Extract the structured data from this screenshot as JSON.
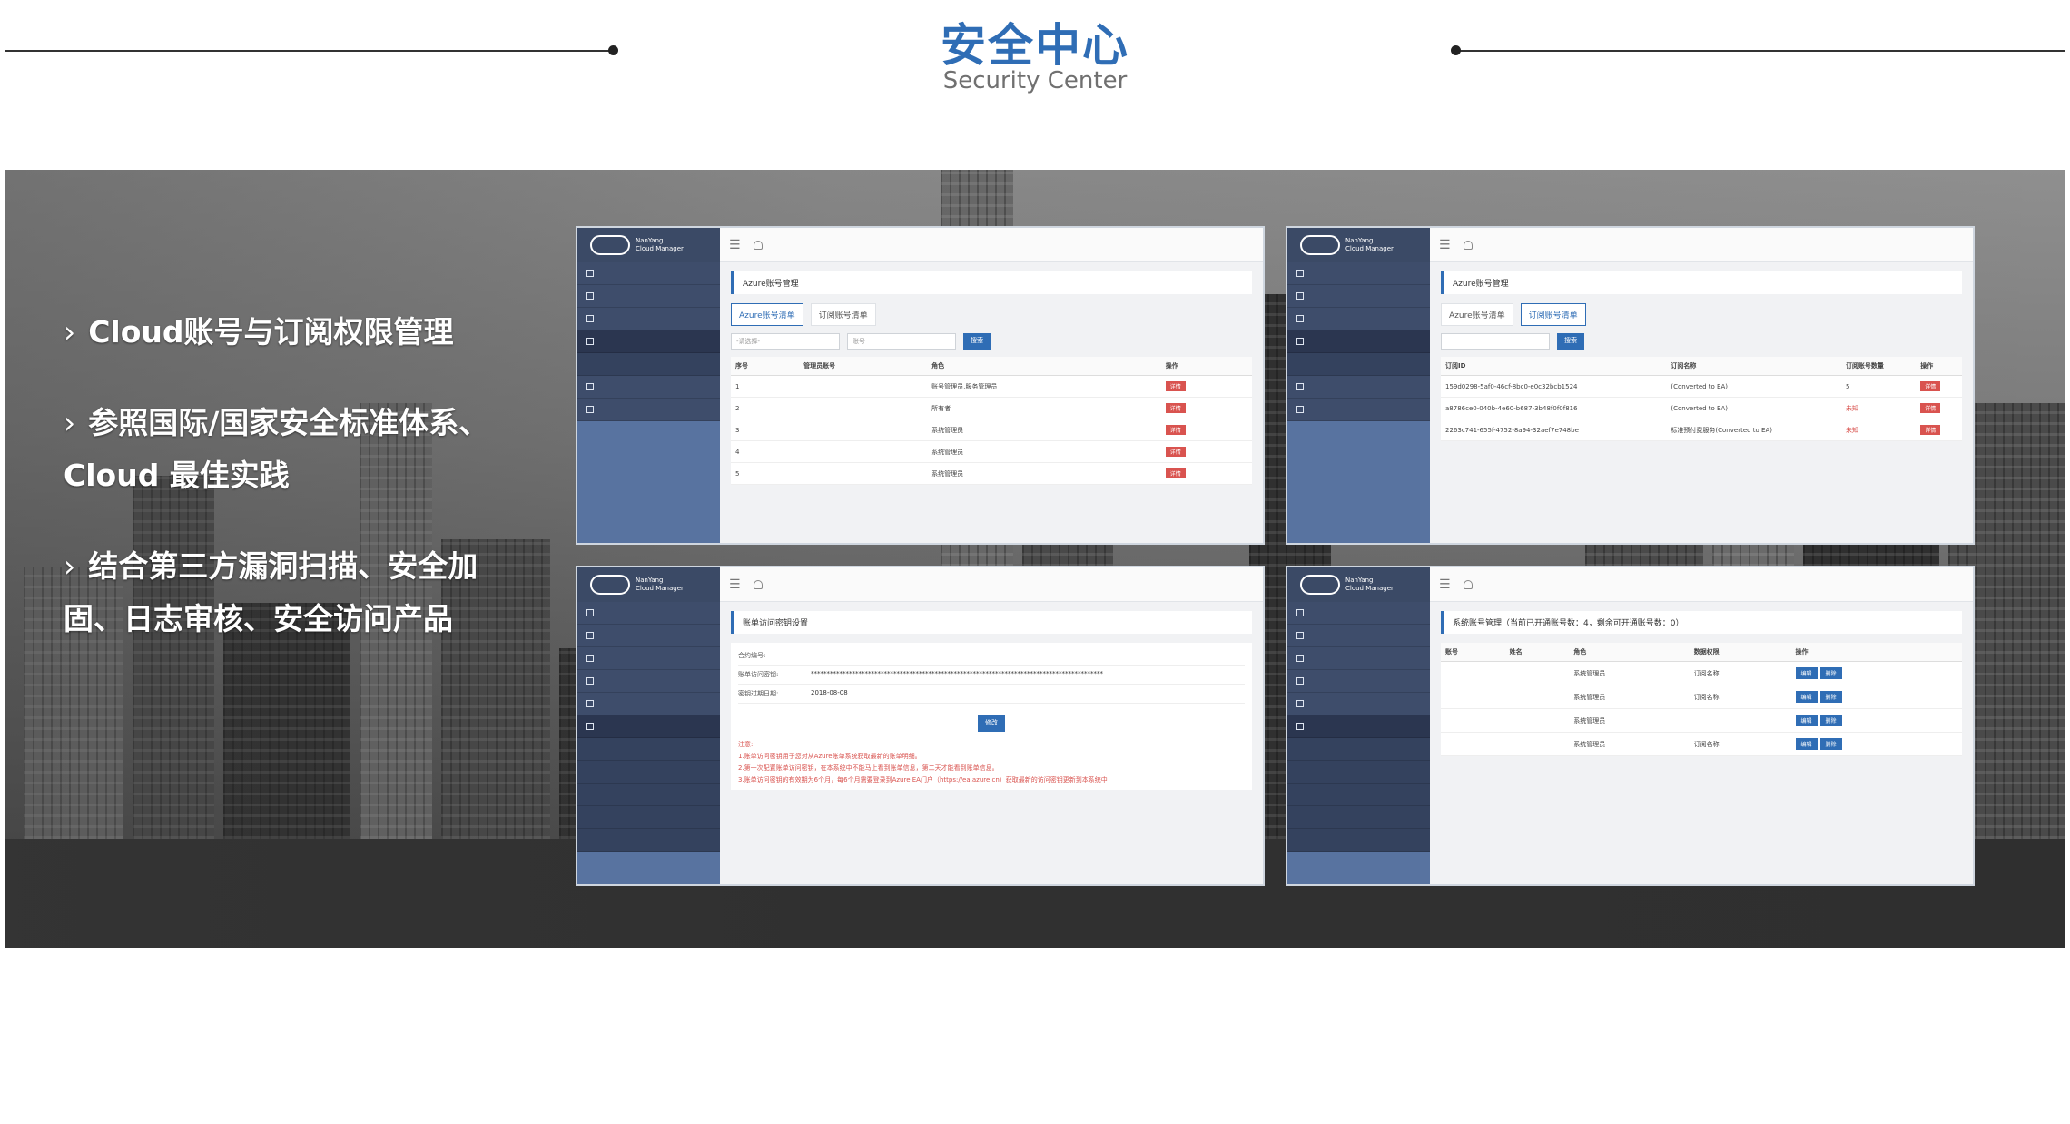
{
  "header": {
    "title": "安全中心",
    "subtitle": "Security Center"
  },
  "features": [
    "Cloud账号与订阅权限管理",
    "参照国际/国家安全标准体系、Cloud 最佳实践",
    "结合第三方漏洞扫描、安全加固、日志审核、安全访问产品"
  ],
  "app": {
    "brand_line1": "NanYang",
    "brand_line2": "Cloud Manager"
  },
  "shot1": {
    "panel_title": "Azure账号管理",
    "tabs": [
      "Azure账号清单",
      "订阅账号清单"
    ],
    "select_placeholder": "-请选择-",
    "input_placeholder": "账号",
    "search_label": "搜索",
    "columns": [
      "序号",
      "管理员账号",
      "角色",
      "操作"
    ],
    "rows": [
      {
        "no": "1",
        "role": "账号管理员,服务管理员",
        "action": "详情"
      },
      {
        "no": "2",
        "role": "所有者",
        "action": "详情"
      },
      {
        "no": "3",
        "role": "系统管理员",
        "action": "详情"
      },
      {
        "no": "4",
        "role": "系统管理员",
        "action": "详情"
      },
      {
        "no": "5",
        "role": "系统管理员",
        "action": "详情"
      }
    ]
  },
  "shot2": {
    "panel_title": "Azure账号管理",
    "tabs": [
      "Azure账号清单",
      "订阅账号清单"
    ],
    "search_label": "搜索",
    "columns": [
      "订阅ID",
      "订阅名称",
      "订阅账号数量",
      "操作"
    ],
    "rows": [
      {
        "id": "159d0298-5af0-46cf-8bc0-e0c32bcb1524",
        "name": "(Converted to EA)",
        "count": "5",
        "action": "详情"
      },
      {
        "id": "a8786ce0-040b-4e60-b687-3b48f0f0f816",
        "name": "(Converted to EA)",
        "count": "未知",
        "action": "详情"
      },
      {
        "id": "2263c741-655f-4752-8a94-32aef7e748be",
        "name": "标准预付费服务(Converted to EA)",
        "count": "未知",
        "action": "详情"
      }
    ]
  },
  "shot3": {
    "panel_title": "账单访问密钥设置",
    "kv": [
      {
        "k": "合约编号:",
        "v": ""
      },
      {
        "k": "账单访问密钥:",
        "v": "********************************************************************************************"
      },
      {
        "k": "密钥过期日期:",
        "v": "2018-08-08"
      }
    ],
    "submit_label": "修改",
    "notes": [
      "注意:",
      "1.账单访问密钥用于您对从Azure账单系统获取最新的账单明细。",
      "2.第一次配置账单访问密钥，在本系统中不能马上看到账单信息，第二天才能看到账单信息。",
      "3.账单访问密钥的有效期为6个月，每6个月需要登录到Azure EA门户（https://ea.azure.cn）获取最新的访问密钥更新到本系统中"
    ]
  },
  "shot4": {
    "panel_title": "系统账号管理（当前已开通账号数：4，剩余可开通账号数：0）",
    "columns": [
      "账号",
      "姓名",
      "角色",
      "数据权限",
      "操作"
    ],
    "rows": [
      {
        "role": "系统管理员",
        "perm": "订阅名称",
        "edit": "编辑",
        "del": "删除"
      },
      {
        "role": "系统管理员",
        "perm": "订阅名称",
        "edit": "编辑",
        "del": "删除"
      },
      {
        "role": "系统管理员",
        "perm": "",
        "edit": "编辑",
        "del": "删除"
      },
      {
        "role": "系统管理员",
        "perm": "订阅名称",
        "edit": "编辑",
        "del": "删除"
      }
    ]
  }
}
